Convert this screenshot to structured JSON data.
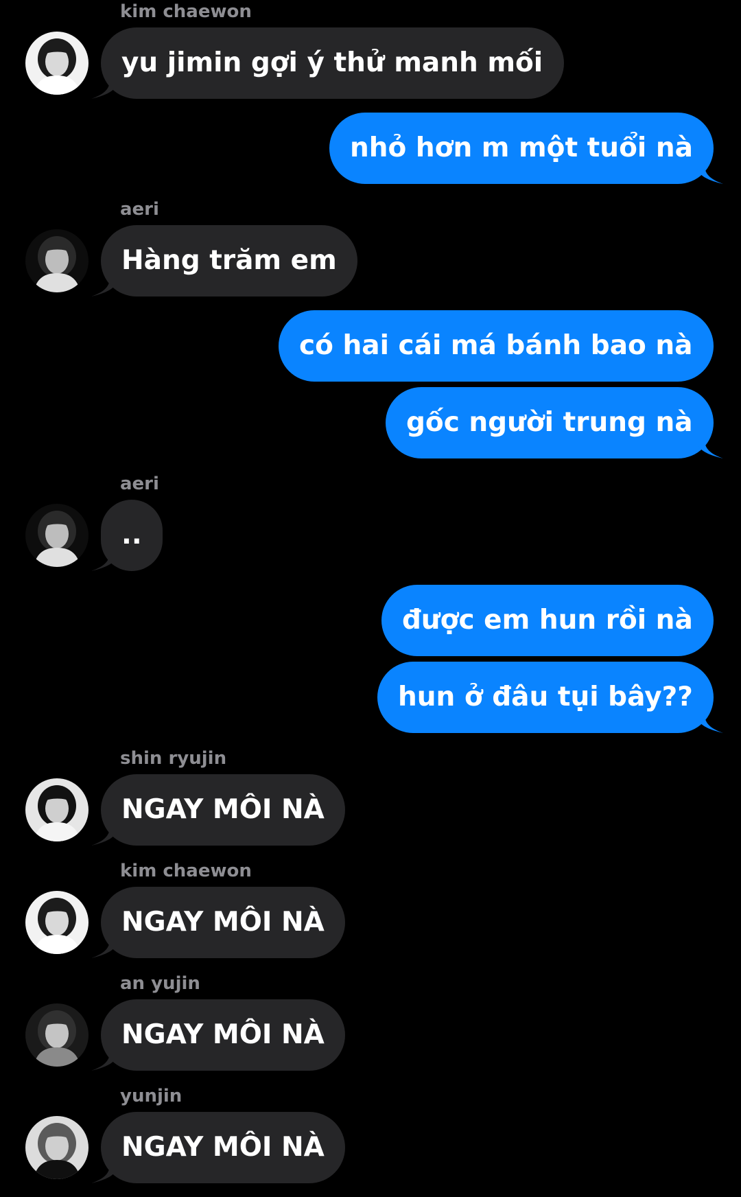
{
  "colors": {
    "background": "#000000",
    "incoming_bubble": "#262628",
    "outgoing_bubble": "#0a84ff",
    "sender_name": "#8e8e93",
    "text": "#ffffff"
  },
  "messages": [
    {
      "direction": "incoming",
      "sender": "kim chaewon",
      "text": "yu jimin gợi ý thử manh mối",
      "tail": true,
      "avatar": "kim-chaewon-avatar"
    },
    {
      "direction": "outgoing",
      "text": "nhỏ hơn m một tuổi nà",
      "tail": true
    },
    {
      "direction": "incoming",
      "sender": "aeri",
      "text": "Hàng trăm em",
      "tail": true,
      "avatar": "aeri-avatar"
    },
    {
      "direction": "outgoing",
      "text": "có hai cái má bánh bao nà",
      "tail": false
    },
    {
      "direction": "outgoing",
      "text": "gốc người trung nà",
      "tail": true
    },
    {
      "direction": "incoming",
      "sender": "aeri",
      "text": "..",
      "tail": true,
      "avatar": "aeri-avatar"
    },
    {
      "direction": "outgoing",
      "text": "được em hun rồi nà",
      "tail": false
    },
    {
      "direction": "outgoing",
      "text": "hun ở đâu tụi bây??",
      "tail": true
    },
    {
      "direction": "incoming",
      "sender": "shin ryujin",
      "text": "NGAY MÔI NÀ",
      "tail": true,
      "avatar": "shin-ryujin-avatar"
    },
    {
      "direction": "incoming",
      "sender": "kim chaewon",
      "text": "NGAY MÔI NÀ",
      "tail": true,
      "avatar": "kim-chaewon-avatar"
    },
    {
      "direction": "incoming",
      "sender": "an yujin",
      "text": "NGAY MÔI NÀ",
      "tail": true,
      "avatar": "an-yujin-avatar"
    },
    {
      "direction": "incoming",
      "sender": "yunjin",
      "text": "NGAY MÔI NÀ",
      "tail": true,
      "avatar": "yunjin-avatar"
    }
  ]
}
